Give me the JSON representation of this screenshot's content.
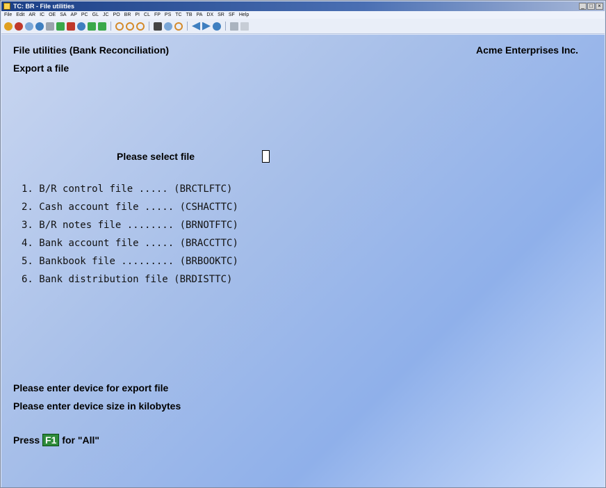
{
  "window": {
    "title": "TC: BR - File utilities"
  },
  "menu": [
    "File",
    "Edit",
    "AR",
    "IC",
    "OE",
    "SA",
    "AP",
    "PC",
    "GL",
    "JC",
    "PO",
    "BR",
    "PI",
    "CL",
    "FP",
    "PS",
    "TC",
    "TB",
    "PA",
    "DX",
    "SR",
    "SF",
    "Help"
  ],
  "toolbar": {
    "icons": [
      "back-icon",
      "stop-icon",
      "refresh-icon",
      "globe-icon",
      "printer-icon",
      "check-icon",
      "cancel-icon",
      "undo-icon",
      "up-arrow-icon",
      "down-arrow-icon",
      "circle-icon",
      "circle-icon",
      "circle-icon",
      "binoculars-icon",
      "magnifier-icon",
      "circle-icon",
      "prev-icon",
      "next-icon",
      "help-icon",
      "document-icon",
      "calculator-icon"
    ]
  },
  "screen": {
    "title": "File utilities (Bank Reconciliation)",
    "company": "Acme Enterprises Inc.",
    "subtitle": "Export a file",
    "select_prompt": "Please select file",
    "select_value": "",
    "files": [
      {
        "num": "1.",
        "name": "B/R control file .....",
        "code": "(BRCTLFTC)"
      },
      {
        "num": "2.",
        "name": "Cash account file .....",
        "code": "(CSHACTTC)"
      },
      {
        "num": "3.",
        "name": "B/R notes file ........",
        "code": "(BRNOTFTC)"
      },
      {
        "num": "4.",
        "name": "Bank account file .....",
        "code": "(BRACCTTC)"
      },
      {
        "num": "5.",
        "name": "Bankbook file .........",
        "code": "(BRBOOKTC)"
      },
      {
        "num": "6.",
        "name": "Bank distribution file",
        "code": "(BRDISTTC)"
      }
    ],
    "device_prompt": "Please enter device for export file",
    "size_prompt": "Please enter device size in kilobytes",
    "press_label": "Press",
    "f1_key": "F1",
    "for_all": "for \"All\""
  }
}
